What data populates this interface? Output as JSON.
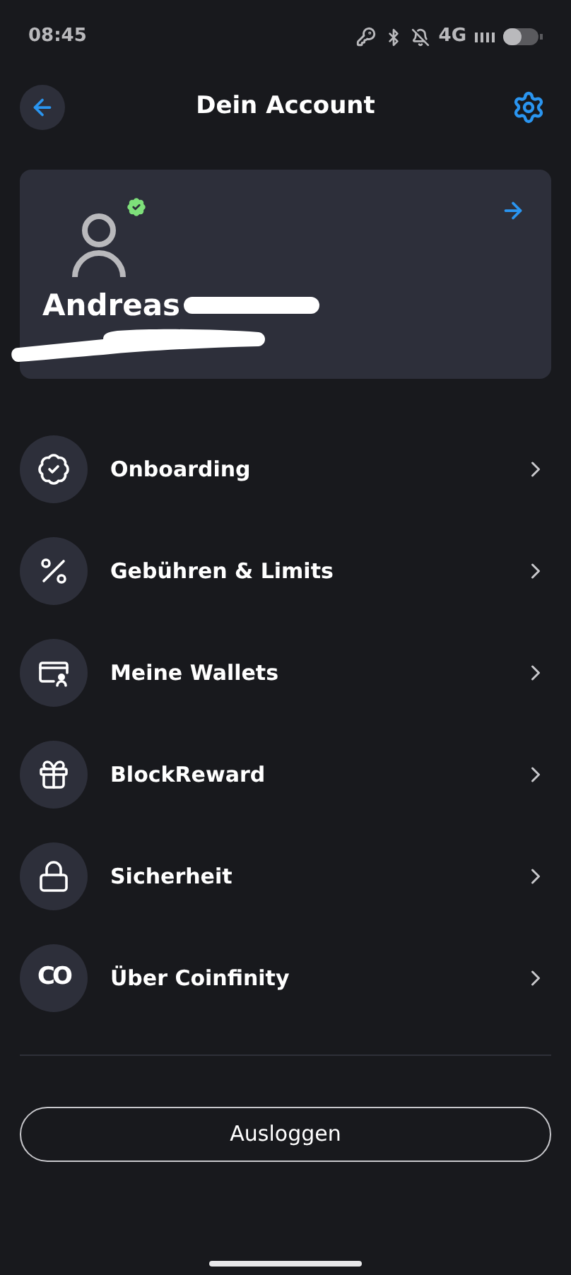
{
  "status_bar": {
    "time": "08:45",
    "network": "4G"
  },
  "header": {
    "title": "Dein Account"
  },
  "profile": {
    "name": "Andreas",
    "verified": true,
    "redacted": true
  },
  "menu": [
    {
      "kind": "badge-check",
      "label": "Onboarding"
    },
    {
      "kind": "percent",
      "label": "Gebühren & Limits"
    },
    {
      "kind": "wallet",
      "label": "Meine Wallets"
    },
    {
      "kind": "gift",
      "label": "BlockReward"
    },
    {
      "kind": "lock",
      "label": "Sicherheit"
    },
    {
      "kind": "logo",
      "logo_text": "CO",
      "label": "Über Coinfinity"
    }
  ],
  "logout_button": "Ausloggen"
}
